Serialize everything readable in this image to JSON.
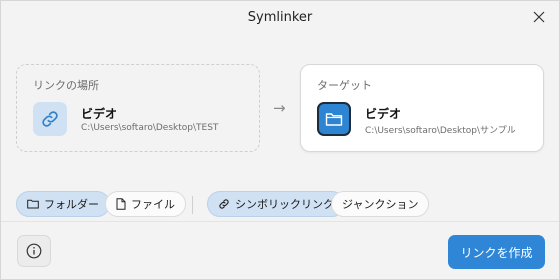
{
  "window": {
    "title": "Symlinker"
  },
  "source": {
    "label": "リンクの場所",
    "name": "ビデオ",
    "path": "C:\\Users\\softaro\\Desktop\\TEST",
    "icon": "link-icon"
  },
  "arrow": "→",
  "target": {
    "label": "ターゲット",
    "name": "ビデオ",
    "path": "C:\\Users\\softaro\\Desktop\\サンプル",
    "icon": "folder-icon"
  },
  "type_options": [
    {
      "label": "フォルダー",
      "icon": "folder-icon",
      "selected": true
    },
    {
      "label": "ファイル",
      "icon": "file-icon",
      "selected": false
    }
  ],
  "link_options": [
    {
      "label": "シンボリックリンク",
      "icon": "link-icon",
      "selected": true
    },
    {
      "label": "ジャンクション",
      "selected": false
    }
  ],
  "footer": {
    "create_label": "リンクを作成",
    "info_icon": "info-icon"
  },
  "colors": {
    "accent": "#2f86d6",
    "chip_active": "#cfe1f3"
  }
}
